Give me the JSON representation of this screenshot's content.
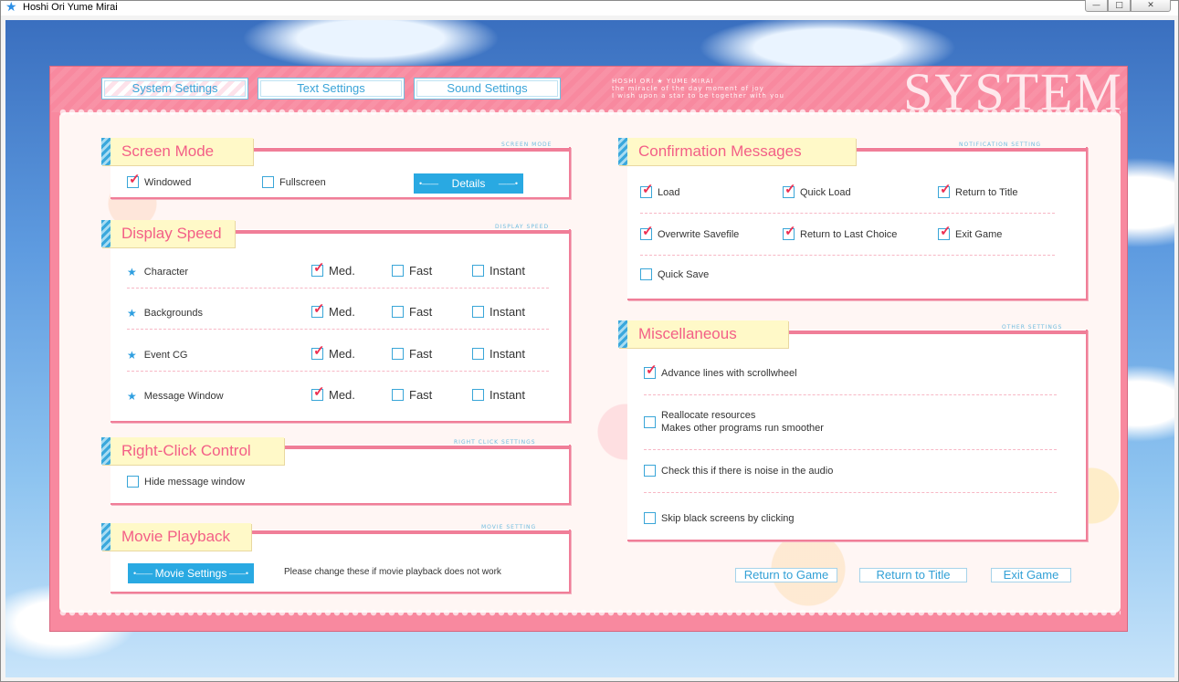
{
  "window": {
    "title": "Hoshi Ori Yume Mirai",
    "controls": [
      "—",
      "□",
      "✕"
    ]
  },
  "brand": {
    "line1": "HOSHI ORI ★ YUME MIRAI",
    "line2": "the miracle of the day moment of joy",
    "line3": "I wish upon a star to be together with you",
    "big_title": "SYSTEM"
  },
  "tabs": [
    "System Settings",
    "Text Settings",
    "Sound Settings"
  ],
  "screen_mode": {
    "title": "Screen Mode",
    "sub": "SCREEN MODE",
    "options": [
      {
        "label": "Windowed",
        "checked": true
      },
      {
        "label": "Fullscreen",
        "checked": false
      }
    ],
    "details_button": "Details"
  },
  "display_speed": {
    "title": "Display Speed",
    "sub": "DISPLAY SPEED",
    "columns": [
      "Med.",
      "Fast",
      "Instant"
    ],
    "rows": [
      {
        "label": "Character",
        "selected": 0
      },
      {
        "label": "Backgrounds",
        "selected": 0
      },
      {
        "label": "Event CG",
        "selected": 0
      },
      {
        "label": "Message Window",
        "selected": 0
      }
    ]
  },
  "right_click": {
    "title": "Right-Click Control",
    "sub": "RIGHT CLICK SETTINGS",
    "option": {
      "label": "Hide message window",
      "checked": false
    }
  },
  "movie": {
    "title": "Movie Playback",
    "sub": "MOVIE SETTING",
    "button": "Movie Settings",
    "note": "Please change these if movie playback does not work"
  },
  "confirmation": {
    "title": "Confirmation Messages",
    "sub": "NOTIFICATION SETTING",
    "items": [
      {
        "label": "Load",
        "checked": true
      },
      {
        "label": "Quick Load",
        "checked": true
      },
      {
        "label": "Return to Title",
        "checked": true
      },
      {
        "label": "Overwrite Savefile",
        "checked": true
      },
      {
        "label": "Return to Last Choice",
        "checked": true
      },
      {
        "label": "Exit Game",
        "checked": true
      },
      {
        "label": "Quick Save",
        "checked": false
      }
    ]
  },
  "misc": {
    "title": "Miscellaneous",
    "sub": "OTHER SETTINGS",
    "items": [
      {
        "label": "Advance lines with scrollwheel",
        "checked": true
      },
      {
        "label": "Reallocate resources",
        "label2": "Makes other programs run smoother",
        "checked": false
      },
      {
        "label": "Check this if there is noise in the audio",
        "checked": false
      },
      {
        "label": "Skip black screens by clicking",
        "checked": false
      }
    ]
  },
  "nav": [
    "Return to Game",
    "Return to Title",
    "Exit Game"
  ],
  "colors": {
    "accent_pink": "#f8899f",
    "accent_blue": "#29a9e2",
    "check_red": "#ec3052"
  }
}
